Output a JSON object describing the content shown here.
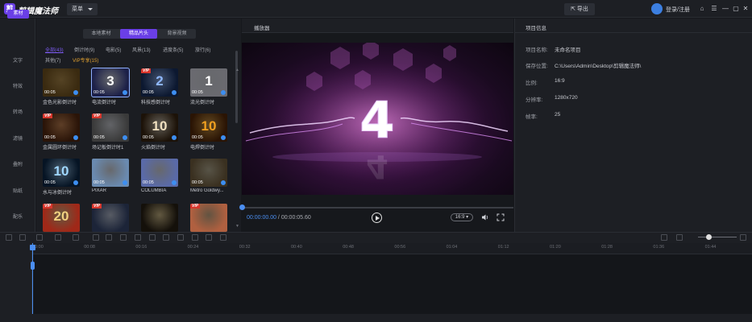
{
  "titlebar": {
    "app_logo": "剪",
    "app_title": "剪辑魔法师",
    "menu_label": "菜单",
    "export_label": "导出",
    "login_label": "登录/注册",
    "controls": [
      "⌂",
      "☰",
      "—",
      "▢",
      "✕"
    ]
  },
  "leftnav": {
    "active_item": "素材",
    "items": [
      "文字",
      "特效",
      "转场",
      "滤镜",
      "叠附",
      "贴纸",
      "配乐"
    ]
  },
  "materials": {
    "tabs": [
      "本地素材",
      "精品片头",
      "背景视频"
    ],
    "active_tab_index": 1,
    "categories": [
      {
        "label": "全部(43)",
        "state": "active"
      },
      {
        "label": "倒计时(9)",
        "state": "normal"
      },
      {
        "label": "电影(5)",
        "state": "normal"
      },
      {
        "label": "风景(13)",
        "state": "normal"
      },
      {
        "label": "进度条(5)",
        "state": "normal"
      },
      {
        "label": "旅行(6)",
        "state": "normal"
      },
      {
        "label": "其他(7)",
        "state": "normal"
      },
      {
        "label": "VIP专享(15)",
        "state": "vip"
      }
    ],
    "cards": [
      {
        "label": "金色光影倒计时",
        "duration": "00:05",
        "vip": false,
        "big": "",
        "color": "#c8902a",
        "bg": "#3a2a10"
      },
      {
        "label": "电流倒计时",
        "duration": "00:05",
        "vip": false,
        "big": "3",
        "color": "#ffffff",
        "bg": "#1c2048"
      },
      {
        "label": "科技感倒计时",
        "duration": "00:05",
        "vip": true,
        "big": "2",
        "color": "#8fb8ff",
        "bg": "#0c1830"
      },
      {
        "label": "流光倒计时",
        "duration": "00:05",
        "vip": false,
        "big": "1",
        "color": "#ffffff",
        "bg": "#6a6a70"
      },
      {
        "label": "金属圆环倒计时",
        "duration": "00:05",
        "vip": true,
        "big": "",
        "color": "#e08030",
        "bg": "#2a1408"
      },
      {
        "label": "场记板倒计时1",
        "duration": "00:05",
        "vip": true,
        "big": "",
        "color": "#f0f0f0",
        "bg": "#3a3a3a"
      },
      {
        "label": "火焰倒计时",
        "duration": "00:05",
        "vip": false,
        "big": "10",
        "color": "#f0e0c0",
        "bg": "#1c1208"
      },
      {
        "label": "电焊倒计时",
        "duration": "00:05",
        "vip": false,
        "big": "10",
        "color": "#f0a020",
        "bg": "#2a1404"
      },
      {
        "label": "水与冰倒计时",
        "duration": "00:05",
        "vip": false,
        "big": "10",
        "color": "#a0d8ff",
        "bg": "#061424"
      },
      {
        "label": "PIXAR",
        "duration": "00:05",
        "vip": false,
        "big": "",
        "color": "#ffffff",
        "bg": "#6a8ab0"
      },
      {
        "label": "COLUMBIA",
        "duration": "00:05",
        "vip": false,
        "big": "",
        "color": "#ffffff",
        "bg": "#5a6aa8"
      },
      {
        "label": "Metro Goldwy...",
        "duration": "00:05",
        "vip": false,
        "big": "",
        "color": "#d0c090",
        "bg": "#3a3020"
      },
      {
        "label": "",
        "duration": "",
        "vip": true,
        "big": "20",
        "color": "#f0d080",
        "bg": "#a02818"
      },
      {
        "label": "",
        "duration": "",
        "vip": true,
        "big": "",
        "color": "#d0d8e8",
        "bg": "#1c2438"
      },
      {
        "label": "",
        "duration": "",
        "vip": false,
        "big": "",
        "color": "#f0d080",
        "bg": "#14100a"
      },
      {
        "label": "",
        "duration": "",
        "vip": true,
        "big": "",
        "color": "#f0c080",
        "bg": "#b06040"
      }
    ]
  },
  "player": {
    "title": "播放器",
    "countdown_digit": "4",
    "time_current": "00:00:00.00",
    "time_separator": " / ",
    "time_total": "00:00:05.60",
    "ratio_label": "16:9 ▾",
    "progress": 0.0
  },
  "project": {
    "title": "项目信息",
    "fields": [
      {
        "key": "项目名称:",
        "value": "未命名项目"
      },
      {
        "key": "保存位置:",
        "value": "C:\\Users\\Admin\\Desktop\\剪辑魔法师\\"
      },
      {
        "key": "比例:",
        "value": "16:9"
      },
      {
        "key": "分辨率:",
        "value": "1280x720"
      },
      {
        "key": "帧率:",
        "value": "25"
      }
    ]
  },
  "timeline": {
    "ticks": [
      "00:00",
      "00:08",
      "00:16",
      "00:24",
      "00:32",
      "00:40",
      "00:48",
      "00:56",
      "01:04",
      "01:12",
      "01:20",
      "01:28",
      "01:36",
      "01:44"
    ]
  },
  "colors": {
    "accent": "#6a3fe6",
    "progress": "#4b8ef0",
    "vip": "#e0a030"
  }
}
